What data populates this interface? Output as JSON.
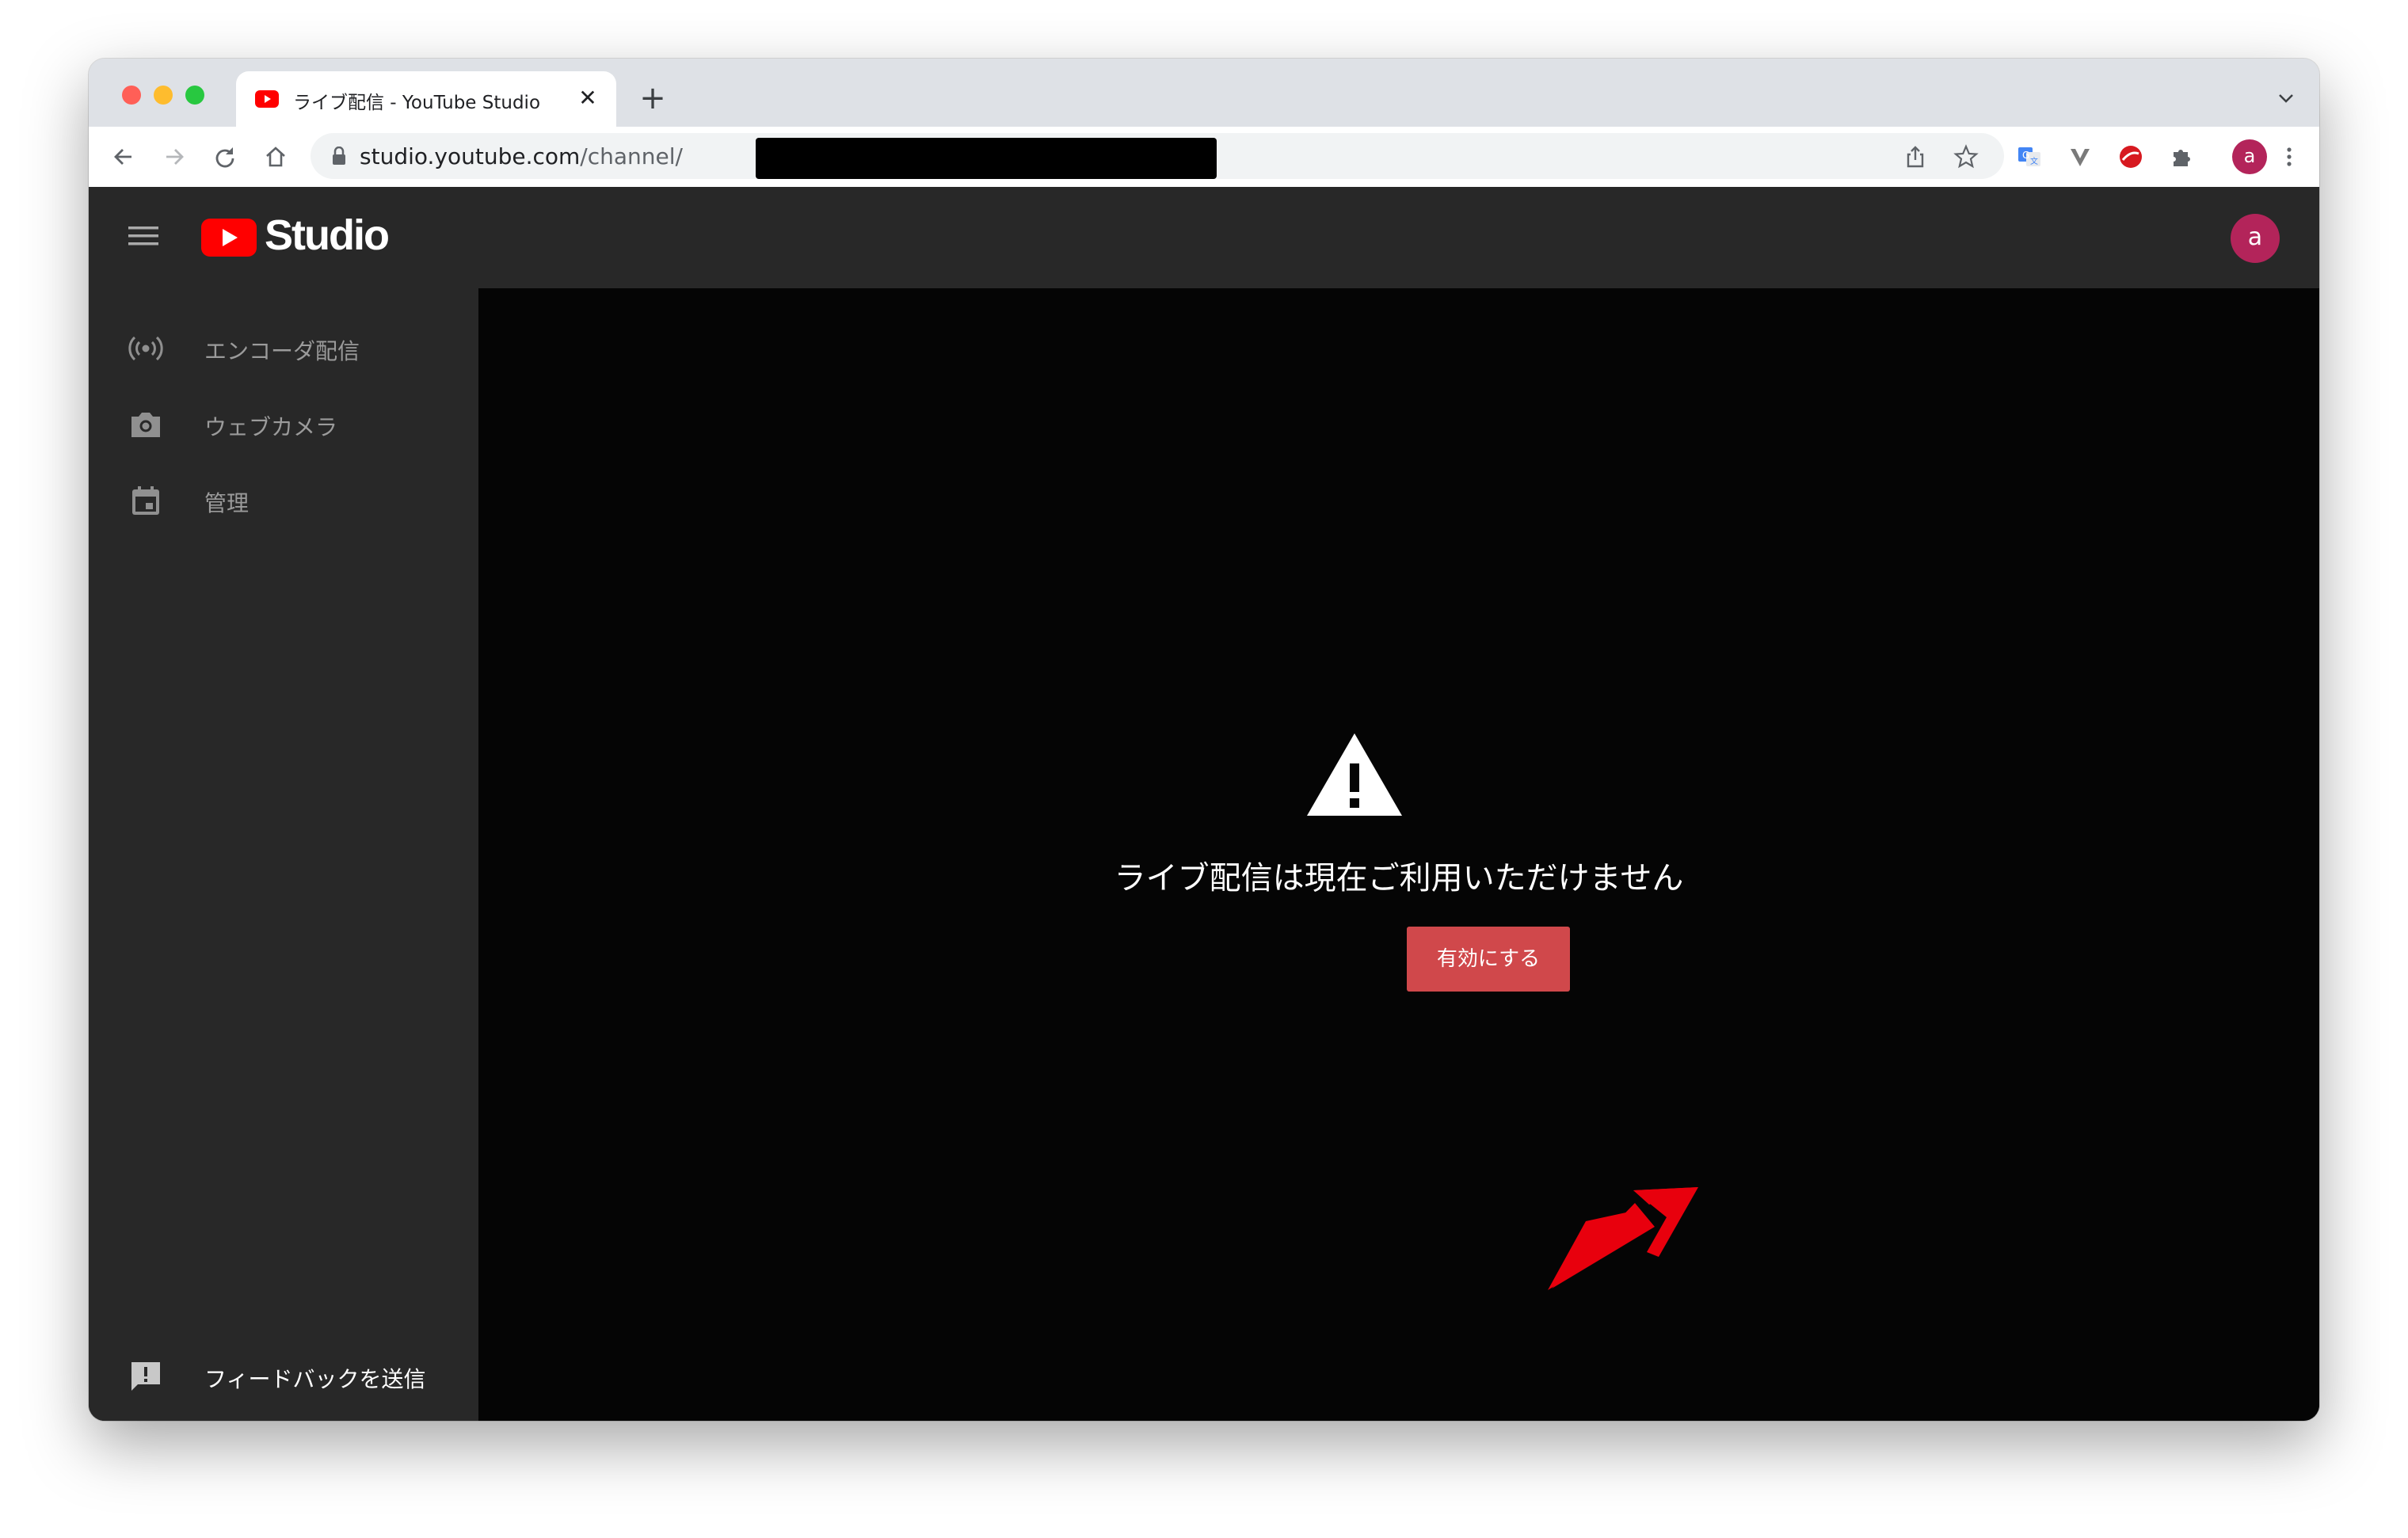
{
  "browser": {
    "tab": {
      "title": "ライブ配信 - YouTube Studio",
      "close_glyph": "✕"
    },
    "new_tab_glyph": "+",
    "url": {
      "host": "studio.youtube.com",
      "path": "/channel/"
    },
    "profile_initial": "a"
  },
  "studio": {
    "brand": "Studio",
    "avatar_initial": "a",
    "sidebar": {
      "items": [
        {
          "label": "エンコーダ配信",
          "icon": "live-broadcast-icon"
        },
        {
          "label": "ウェブカメラ",
          "icon": "camera-icon"
        },
        {
          "label": "管理",
          "icon": "calendar-icon"
        }
      ],
      "feedback": {
        "label": "フィードバックを送信",
        "icon": "feedback-icon"
      }
    },
    "main": {
      "message": "ライブ配信は現在ご利用いただけません",
      "enable_button": "有効にする",
      "warning_icon": "warning-icon"
    }
  },
  "colors": {
    "brand_red": "#ff0000",
    "button_red": "#d0484b",
    "avatar": "#b3245a",
    "annotation_arrow": "#e8000d"
  }
}
